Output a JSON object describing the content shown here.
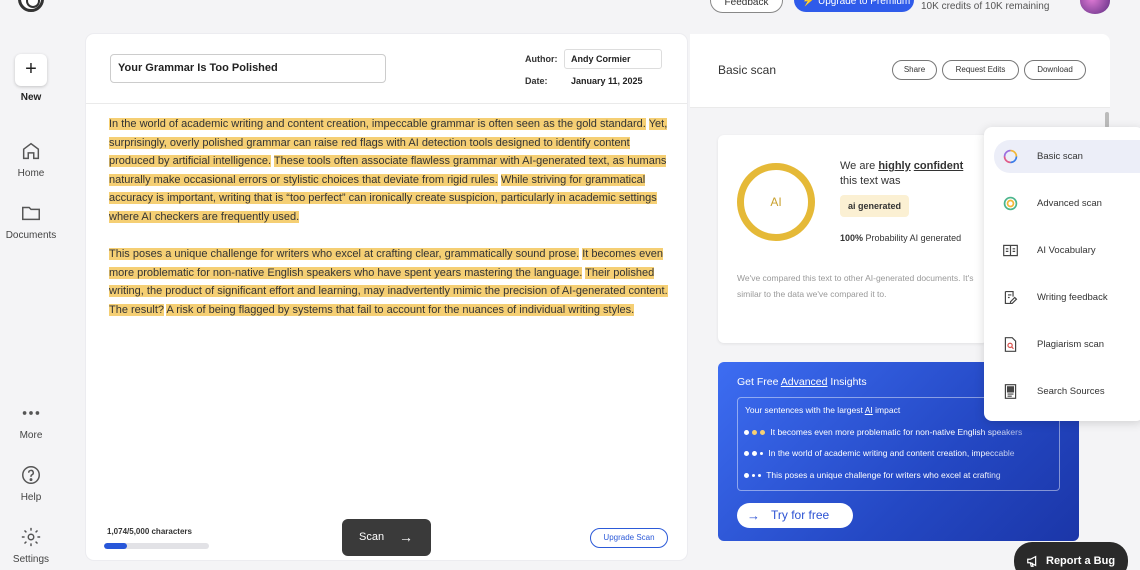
{
  "topbar": {
    "feedback_label": "Feedback",
    "upgrade_label": "Upgrade to Premium",
    "credits": "10K credits of 10K remaining"
  },
  "rail": {
    "new_label": "New",
    "home_label": "Home",
    "documents_label": "Documents",
    "more_label": "More",
    "help_label": "Help",
    "settings_label": "Settings"
  },
  "editor": {
    "title": "Your Grammar Is Too Polished",
    "author_label": "Author:",
    "author": "Andy Cormier",
    "date_label": "Date:",
    "date": "January 11, 2025",
    "paragraph1": [
      "In the world of academic writing and content creation, impeccable grammar is often seen as the gold standard.",
      "Yet, surprisingly, overly polished grammar can raise red flags with AI detection tools designed to identify content produced by artificial intelligence.",
      "These tools often associate flawless grammar with AI-generated text, as humans naturally make occasional errors or stylistic choices that deviate from rigid rules.",
      "While striving for grammatical accuracy is important, writing that is “too perfect” can ironically create suspicion, particularly in academic settings where AI checkers are frequently used."
    ],
    "paragraph2": [
      "This poses a unique challenge for writers who excel at crafting clear, grammatically sound prose.",
      "It becomes even more problematic for non-native English speakers who have spent years mastering the language.",
      "Their polished writing, the product of significant effort and learning, may inadvertently mimic the precision of AI-generated content.",
      "The result?",
      "A risk of being flagged by systems that fail to account for the nuances of individual writing styles."
    ],
    "char_count": "1,074/5,000 characters",
    "char_progress": 0.2148,
    "scan_label": "Scan",
    "upgrade_scan_label": "Upgrade Scan"
  },
  "results": {
    "title": "Basic scan",
    "share_label": "Share",
    "request_edits_label": "Request Edits",
    "download_label": "Download",
    "ring_label": "AI",
    "we_are": "We are",
    "highly": "highly",
    "confident": "confident",
    "text_was": "this text was",
    "verdict": "ai generated",
    "prob_value": "100%",
    "prob_text": "Probability AI generated",
    "compare_text": "We've compared this text to other AI-generated documents. It's similar to the data we've compared it to."
  },
  "insights": {
    "title_pre": "Get Free",
    "title_link": "Advanced",
    "title_post": "Insights",
    "box_title_pre": "Your sentences with the largest",
    "box_title_link": "AI",
    "box_title_post": "impact",
    "rows": [
      "It becomes even more problematic for non-native English speakers",
      "In the world of academic writing and content creation, impeccable",
      "This poses a unique challenge for writers who excel at crafting"
    ],
    "try_label": "Try for free"
  },
  "menu": {
    "items": [
      {
        "label": "Basic scan",
        "icon": "basic-scan-icon"
      },
      {
        "label": "Advanced scan",
        "icon": "advanced-scan-icon"
      },
      {
        "label": "AI Vocabulary",
        "icon": "vocabulary-icon"
      },
      {
        "label": "Writing feedback",
        "icon": "writing-feedback-icon"
      },
      {
        "label": "Plagiarism scan",
        "icon": "plagiarism-icon"
      },
      {
        "label": "Search Sources",
        "icon": "search-sources-icon"
      }
    ]
  },
  "bug_label": "Report a Bug",
  "colors": {
    "highlight": "#f5cf74",
    "accent": "#2c5ad8",
    "ring": "#e5b937"
  }
}
